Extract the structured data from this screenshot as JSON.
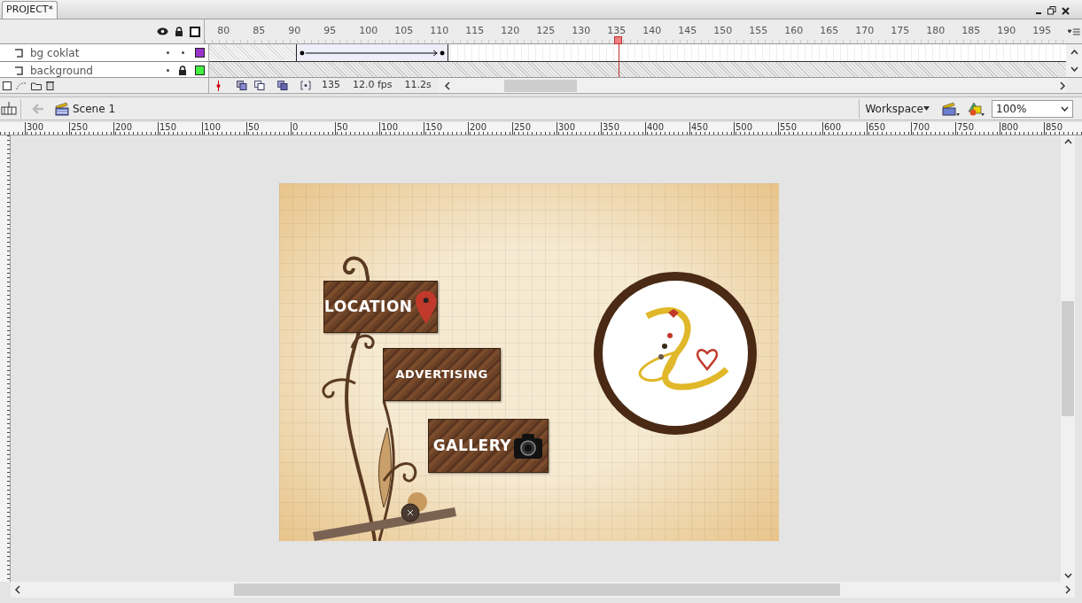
{
  "document_tab": {
    "label": "PROJECT*",
    "selected": true
  },
  "timeline": {
    "frame_numbers": [
      "80",
      "85",
      "90",
      "95",
      "100",
      "105",
      "110",
      "115",
      "120",
      "125",
      "130",
      "135",
      "140",
      "145",
      "150",
      "155",
      "160",
      "165",
      "170",
      "175",
      "180",
      "185",
      "190",
      "195"
    ],
    "layers": [
      {
        "name": "bg coklat",
        "visible": true,
        "locked": false,
        "color": "#9933cc",
        "tween": true
      },
      {
        "name": "background",
        "visible": true,
        "locked": true,
        "color": "#44ee44",
        "tween": false
      }
    ],
    "playhead": {
      "level": 0.478
    },
    "current_frame": "135",
    "frame_rate": "12.0 fps",
    "elapsed_time": "11.2s"
  },
  "edit_bar": {
    "scene": "Scene 1",
    "workspace": "Workspace",
    "zoom": "100%"
  },
  "ruler": [
    "300",
    "250",
    "200",
    "150",
    "100",
    "50",
    "0",
    "50",
    "100",
    "150",
    "200",
    "250",
    "300",
    "350",
    "400",
    "450",
    "500",
    "550",
    "600",
    "650",
    "700",
    "750",
    "800",
    "850"
  ],
  "stage": {
    "buttons": [
      {
        "label": "LOCATION",
        "kind": "pin"
      },
      {
        "label": "ADVERTISING",
        "kind": "plain"
      },
      {
        "label": "GALLERY",
        "kind": "camera"
      }
    ]
  }
}
